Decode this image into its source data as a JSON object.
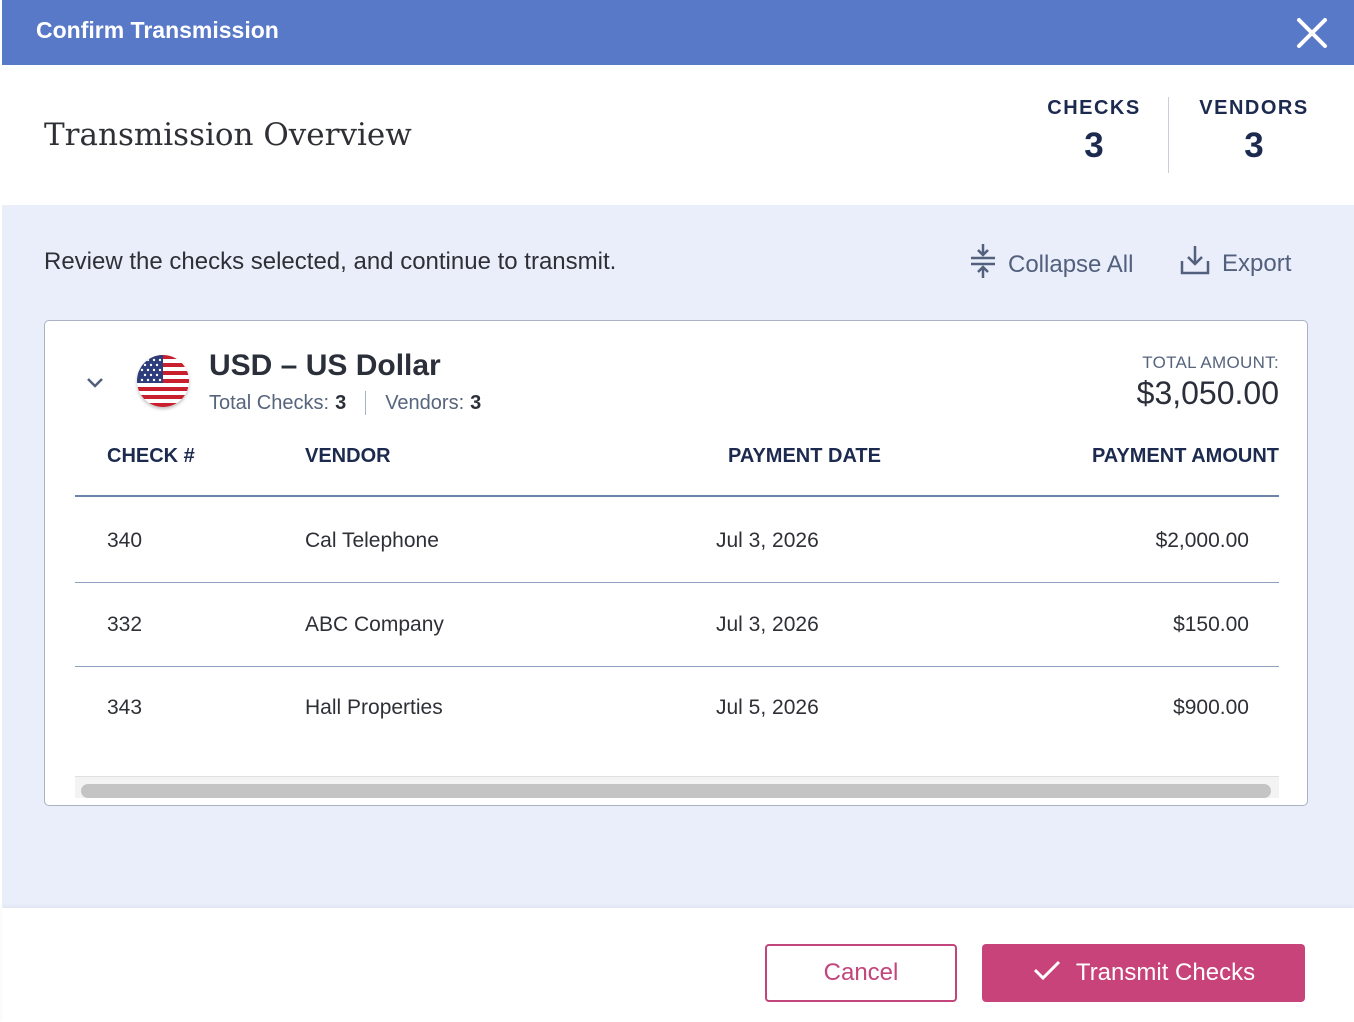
{
  "dialog": {
    "title": "Confirm Transmission"
  },
  "overview": {
    "heading": "Transmission Overview",
    "checks_label": "CHECKS",
    "checks_value": "3",
    "vendors_label": "VENDORS",
    "vendors_value": "3"
  },
  "content": {
    "review_text": "Review the checks selected, and continue to transmit.",
    "collapse_all_label": "Collapse All",
    "export_label": "Export"
  },
  "currency_group": {
    "name": "USD – US Dollar",
    "flag_icon": "us-flag-icon",
    "total_checks_label": "Total Checks:",
    "total_checks_value": "3",
    "vendors_label": "Vendors:",
    "vendors_value": "3",
    "total_amount_label": "TOTAL AMOUNT:",
    "total_amount_value": "$3,050.00"
  },
  "table": {
    "columns": [
      "CHECK #",
      "VENDOR",
      "PAYMENT DATE",
      "PAYMENT AMOUNT"
    ],
    "rows": [
      {
        "check": "340",
        "vendor": "Cal Telephone",
        "date": "Jul 3, 2026",
        "amount": "$2,000.00"
      },
      {
        "check": "332",
        "vendor": "ABC Company",
        "date": "Jul 3, 2026",
        "amount": "$150.00"
      },
      {
        "check": "343",
        "vendor": "Hall Properties",
        "date": "Jul 5, 2026",
        "amount": "$900.00"
      }
    ]
  },
  "footer": {
    "cancel_label": "Cancel",
    "transmit_label": "Transmit Checks"
  },
  "colors": {
    "titlebar": "#5878c8",
    "accent": "#c8437a",
    "content_bg": "#eaeefa",
    "heading_navy": "#1b2a4e"
  }
}
